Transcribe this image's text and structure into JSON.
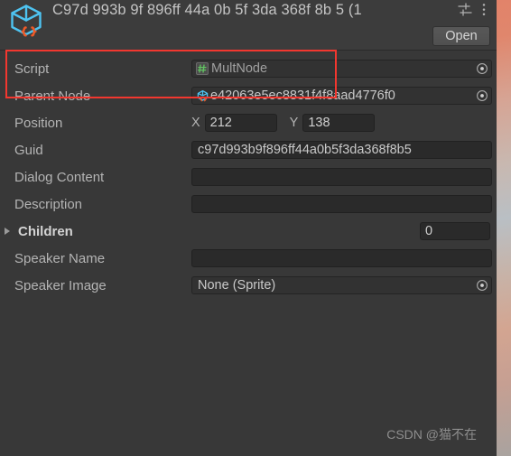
{
  "window": {
    "title": "C97d 993b 9f 896ff 44a 0b 5f 3da 368f 8b 5 (1",
    "asset_icon": "scriptable-object-cube-braces-icon",
    "preset_icon": "preset-settings-icon",
    "kebab_icon": "more-menu-icon",
    "open_label": "Open",
    "accent_red": "#f2372f",
    "panel_bg": "#383838",
    "field_bg": "#2a2a2a"
  },
  "properties": {
    "script": {
      "label": "Script",
      "value": "MultNode",
      "icon": "cs-script-icon",
      "picker_icon": "object-picker-icon"
    },
    "parent_node": {
      "label": "Parent Node",
      "value": "e42063e5ec8831f4f8aad4776f0",
      "icon": "scriptable-object-cube-braces-icon",
      "picker_icon": "object-picker-icon"
    },
    "position": {
      "label": "Position",
      "x_label": "X",
      "x_value": "212",
      "y_label": "Y",
      "y_value": "138"
    },
    "guid": {
      "label": "Guid",
      "value": "c97d993b9f896ff44a0b5f3da368f8b5"
    },
    "dialog_content": {
      "label": "Dialog Content",
      "value": ""
    },
    "description": {
      "label": "Description",
      "value": ""
    },
    "children": {
      "label": "Children",
      "count": "0",
      "expanded": false
    },
    "speaker_name": {
      "label": "Speaker Name",
      "value": ""
    },
    "speaker_image": {
      "label": "Speaker Image",
      "value": "None (Sprite)",
      "picker_icon": "object-picker-icon"
    }
  },
  "watermark": {
    "text": "CSDN @猫不在"
  }
}
